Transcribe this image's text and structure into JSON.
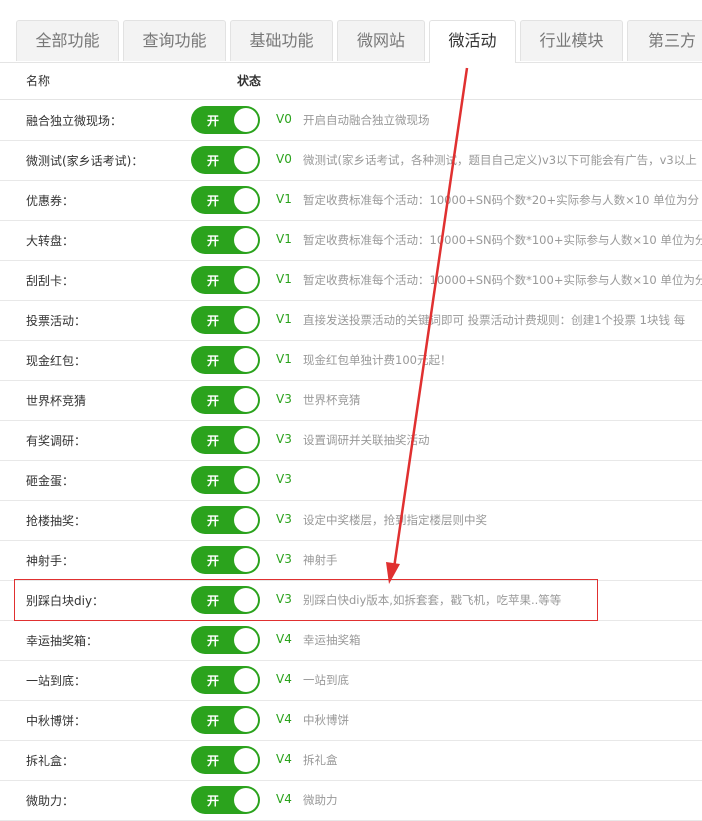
{
  "tabs": [
    {
      "label": "全部功能"
    },
    {
      "label": "查询功能"
    },
    {
      "label": "基础功能"
    },
    {
      "label": "微网站"
    },
    {
      "label": "微活动",
      "active": true
    },
    {
      "label": "行业模块"
    },
    {
      "label": "第三方"
    }
  ],
  "header": {
    "name": "名称",
    "status": "状态"
  },
  "toggle_label": "开",
  "colors": {
    "accent": "#2ba31d",
    "annotation": "#e03030"
  },
  "rows": [
    {
      "name": "融合独立微现场：",
      "version": "V0",
      "desc": "开启自动融合独立微现场"
    },
    {
      "name": "微测试(家乡话考试)：",
      "version": "V0",
      "desc": "微测试(家乡话考试，各种测试，题目自己定义)v3以下可能会有广告，v3以上"
    },
    {
      "name": "优惠券：",
      "version": "V1",
      "desc": "暂定收费标准每个活动：10000+SN码个数*20+实际参与人数×10 单位为分"
    },
    {
      "name": "大转盘：",
      "version": "V1",
      "desc": "暂定收费标准每个活动：10000+SN码个数*100+实际参与人数×10 单位为分"
    },
    {
      "name": "刮刮卡：",
      "version": "V1",
      "desc": "暂定收费标准每个活动：10000+SN码个数*100+实际参与人数×10 单位为分"
    },
    {
      "name": "投票活动：",
      "version": "V1",
      "desc": "直接发送投票活动的关键词即可 投票活动计费规则：创建1个投票 1块钱 每"
    },
    {
      "name": "现金红包：",
      "version": "V1",
      "desc": "现金红包单独计费100元起！"
    },
    {
      "name": "世界杯竞猜",
      "version": "V3",
      "desc": "世界杯竞猜"
    },
    {
      "name": "有奖调研：",
      "version": "V3",
      "desc": "设置调研并关联抽奖活动"
    },
    {
      "name": "砸金蛋：",
      "version": "V3",
      "desc": ""
    },
    {
      "name": "抢楼抽奖：",
      "version": "V3",
      "desc": "设定中奖楼层，抢到指定楼层则中奖"
    },
    {
      "name": "神射手：",
      "version": "V3",
      "desc": "神射手"
    },
    {
      "name": "别踩白块diy：",
      "version": "V3",
      "desc": "别踩白快diy版本,如拆套套，戳飞机，吃苹果..等等"
    },
    {
      "name": "幸运抽奖箱：",
      "version": "V4",
      "desc": "幸运抽奖箱"
    },
    {
      "name": "一站到底：",
      "version": "V4",
      "desc": "一站到底"
    },
    {
      "name": "中秋博饼：",
      "version": "V4",
      "desc": "中秋博饼"
    },
    {
      "name": "拆礼盒：",
      "version": "V4",
      "desc": "拆礼盒"
    },
    {
      "name": "微助力：",
      "version": "V4",
      "desc": "微助力"
    }
  ]
}
